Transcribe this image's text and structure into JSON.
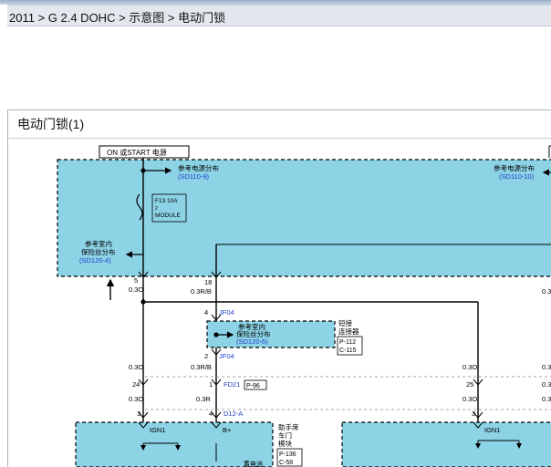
{
  "breadcrumb": "2011 > G 2.4 DOHC > 示意图 > 电动门锁",
  "panel_title": "电动门锁(1)",
  "colors": {
    "box_fill": "#8cd3e6",
    "ref_text": "#1e3ec8",
    "wire": "#000000"
  },
  "diagram": {
    "on_start_label": "ON 或START 电源",
    "ref_power_left": {
      "label": "参考电源分布",
      "ref": "(SD110-9)"
    },
    "ref_power_right": {
      "label": "参考电源分布",
      "ref": "(SD110-10)"
    },
    "fuse": {
      "line1": "F13 10A",
      "line2": "2",
      "line3": "MODULE"
    },
    "ref_indoor_left": {
      "line1": "参考室内",
      "line2": "保险丝分布",
      "ref": "(SD120-4)"
    },
    "wire_left_top": {
      "pin": "5",
      "gauge": "0.3O"
    },
    "wire_mid_top": {
      "pin": "18",
      "gauge": "0.3R/B"
    },
    "wire_right_top": {
      "gauge": "0.3"
    },
    "jf04_top": {
      "pin": "4",
      "name": "JF04"
    },
    "jf04_box": {
      "line1": "参考室内",
      "line2": "保险丝分布",
      "ref": "(SD120-6)"
    },
    "short_connector": {
      "line1": "短接",
      "line2": "连接器",
      "code1": "P-112",
      "code2": "C-115"
    },
    "jf04_bottom": {
      "pin": "2",
      "name": "JF04"
    },
    "left_col": {
      "gauge1": "0.3O",
      "pin": "24",
      "gauge2": "0.3O",
      "pin2": "3"
    },
    "mid_col": {
      "gauge1": "0.3R/B",
      "pin": "1",
      "conn": "FD21",
      "conn_box": "P-96",
      "gauge2": "0.3R",
      "pin2": "4",
      "conn2": "D12-A"
    },
    "right_col": {
      "gauge1": "0.3O",
      "pin": "25",
      "gauge2": "0.3O",
      "pin2": "3"
    },
    "far_right": {
      "g1": "0.3",
      "g2": "0.3",
      "g3": "0.3"
    },
    "bottom_left": {
      "ign": "IGN1",
      "bplus": "B+"
    },
    "passenger_module": {
      "line1": "助手席",
      "line2": "车门",
      "line3": "模块",
      "code1": "P-136",
      "code2": "C-58"
    },
    "bottom_right": {
      "ign": "IGN1"
    },
    "bottom_cut_text": "蓄电池"
  }
}
